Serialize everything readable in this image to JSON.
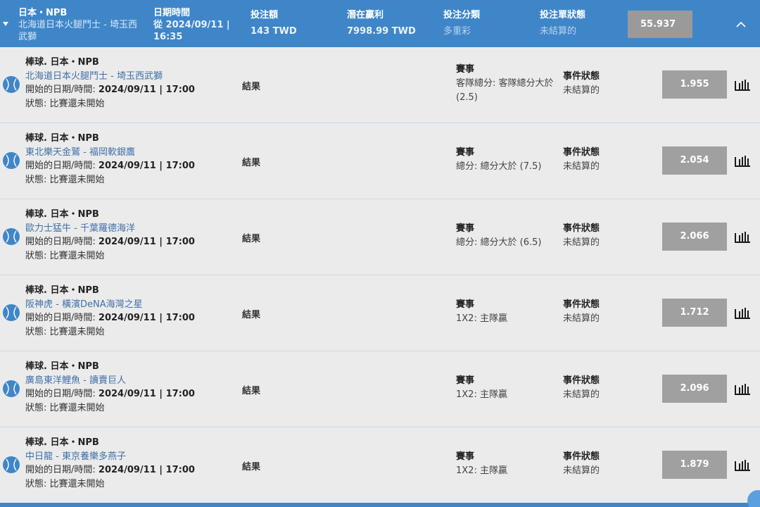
{
  "header": {
    "league": "日本・NPB",
    "match": "北海道日本火腿鬥士 - 埼玉西武獅",
    "datetime_label": "日期時間",
    "datetime_value": "從 2024/09/11 | 16:35",
    "stake_label": "投注額",
    "stake_value": "143 TWD",
    "potential_label": "潛在贏利",
    "potential_value": "7998.99 TWD",
    "category_label": "投注分類",
    "category_value": "多重彩",
    "slip_status_label": "投注單狀態",
    "slip_status_value": "未結算的",
    "total_odds": "55.937",
    "icons": {
      "expand": "caret-down-icon",
      "collapse": "chevron-up-icon"
    }
  },
  "labels": {
    "start_prefix": "開始的日期/時間:",
    "result": "結果",
    "market_title": "賽事",
    "event_status_title": "事件狀態"
  },
  "selections": [
    {
      "league": "棒球. 日本・NPB",
      "teams": "北海道日本火腿鬥士 - 埼玉西武獅",
      "start": "2024/09/11 | 17:00",
      "status": "狀態: 比賽還未開始",
      "market": "客隊總分: 客隊總分大於 (2.5)",
      "event_status": "未結算的",
      "odds": "1.955"
    },
    {
      "league": "棒球. 日本・NPB",
      "teams": "東北樂天金鷲 - 福岡軟銀鷹",
      "start": "2024/09/11 | 17:00",
      "status": "狀態: 比賽還未開始",
      "market": "總分: 總分大於 (7.5)",
      "event_status": "未結算的",
      "odds": "2.054"
    },
    {
      "league": "棒球. 日本・NPB",
      "teams": "歐力士猛牛 - 千葉羅德海洋",
      "start": "2024/09/11 | 17:00",
      "status": "狀態: 比賽還未開始",
      "market": "總分: 總分大於 (6.5)",
      "event_status": "未結算的",
      "odds": "2.066"
    },
    {
      "league": "棒球. 日本・NPB",
      "teams": "阪神虎 - 橫濱DeNA海灣之星",
      "start": "2024/09/11 | 17:00",
      "status": "狀態: 比賽還未開始",
      "market": "1X2: 主隊贏",
      "event_status": "未結算的",
      "odds": "1.712"
    },
    {
      "league": "棒球. 日本・NPB",
      "teams": "廣島東洋鯉魚 - 讀賣巨人",
      "start": "2024/09/11 | 17:00",
      "status": "狀態: 比賽還未開始",
      "market": "1X2: 主隊贏",
      "event_status": "未結算的",
      "odds": "2.096"
    },
    {
      "league": "棒球. 日本・NPB",
      "teams": "中日龍 - 東京養樂多燕子",
      "start": "2024/09/11 | 17:00",
      "status": "狀態: 比賽還未開始",
      "market": "1X2: 主隊贏",
      "event_status": "未結算的",
      "odds": "1.879"
    }
  ],
  "icons": {
    "sport": "baseball-icon",
    "stats": "bar-chart-icon"
  },
  "colors": {
    "header_bg": "#3f86c9",
    "row_bg": "#ebebeb",
    "team_link": "#3f6fa8",
    "odds_bg": "#a0a0a0"
  }
}
